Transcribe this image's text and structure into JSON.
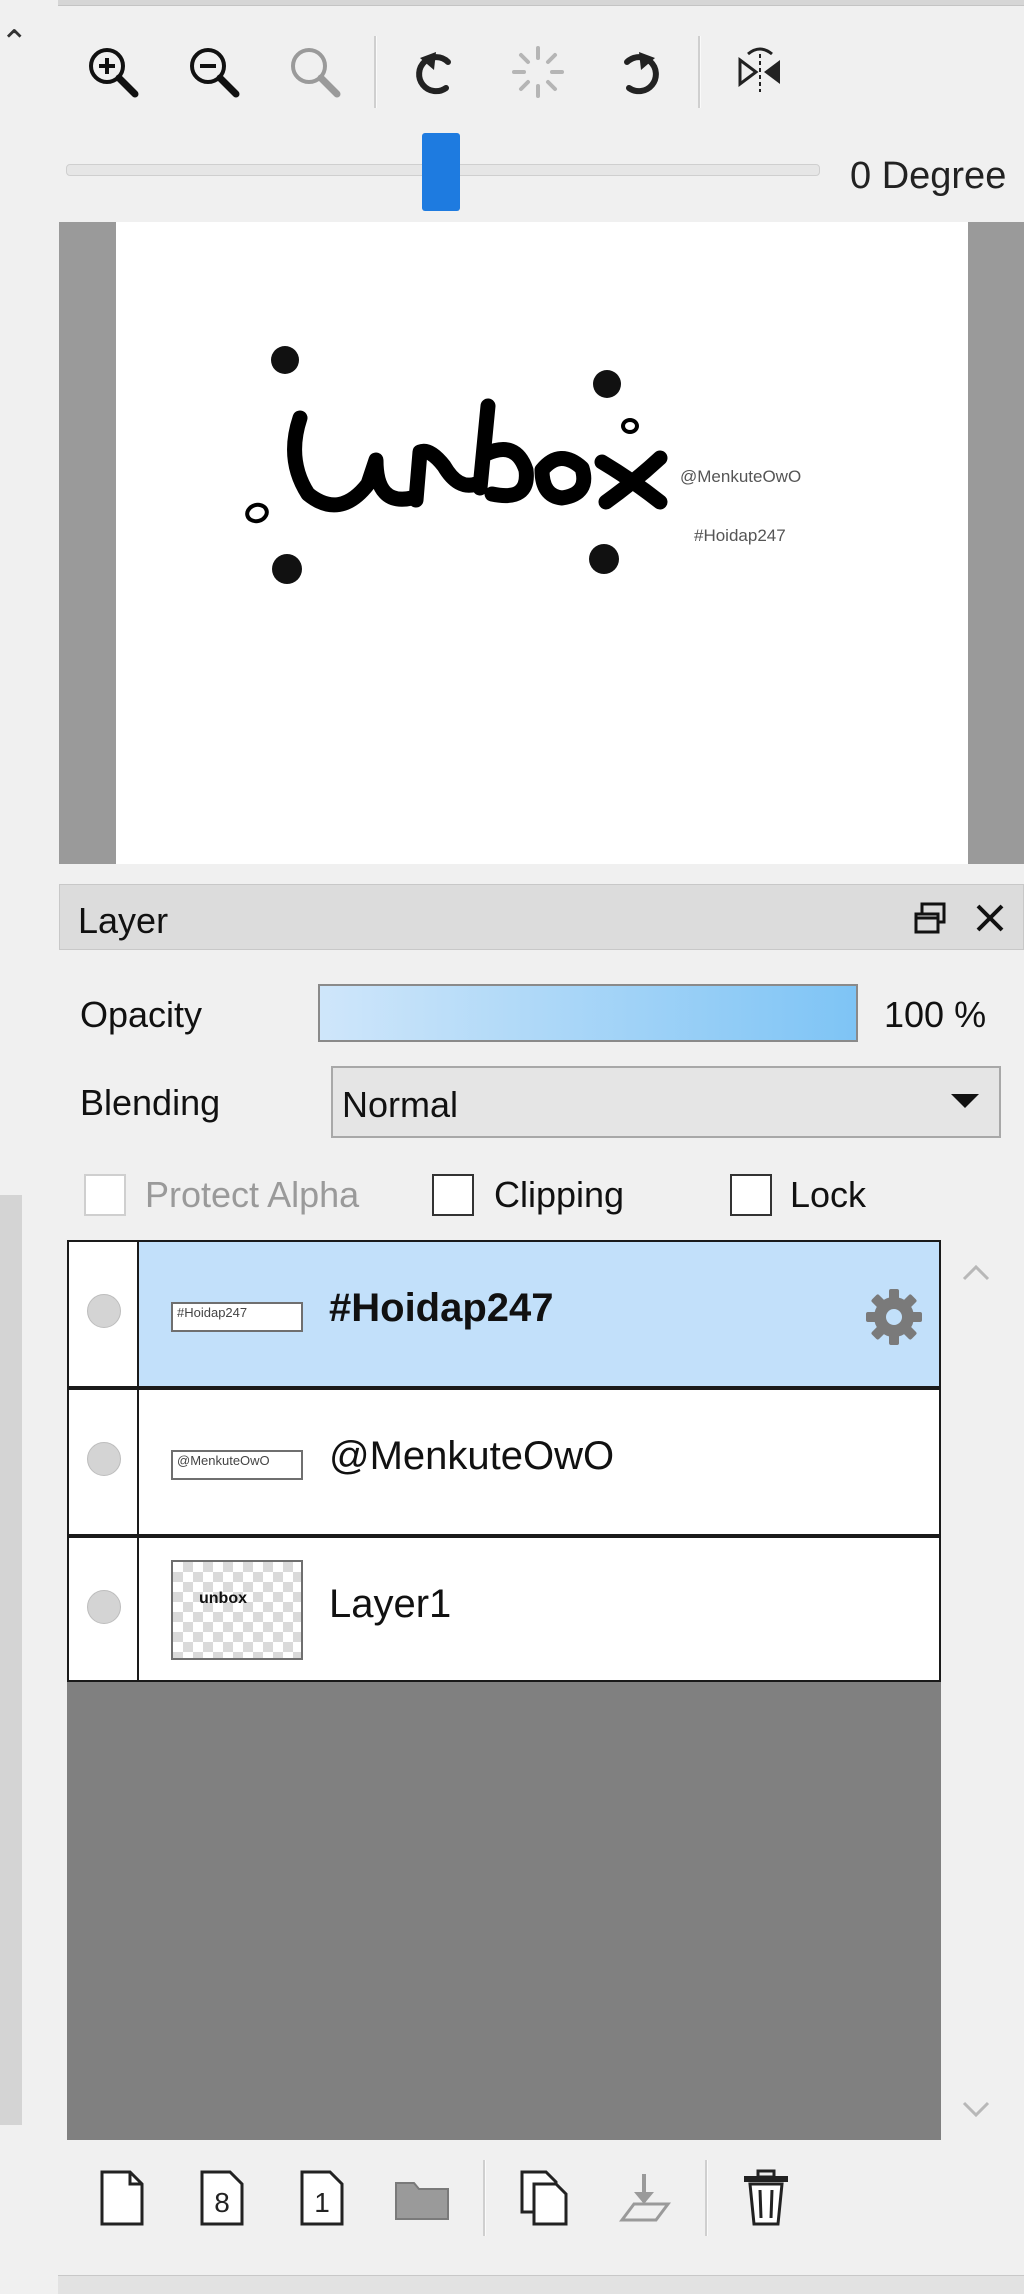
{
  "toolbar": {
    "tools": [
      {
        "name": "zoom-in-icon",
        "enabled": true
      },
      {
        "name": "zoom-out-icon",
        "enabled": true
      },
      {
        "name": "zoom-actual-icon",
        "enabled": false
      },
      {
        "name": "rotate-left-icon",
        "enabled": true
      },
      {
        "name": "rotate-reset-icon",
        "enabled": false
      },
      {
        "name": "rotate-right-icon",
        "enabled": true
      },
      {
        "name": "flip-horizontal-icon",
        "enabled": true
      }
    ]
  },
  "rotation": {
    "label": "0 Degree",
    "value_degrees": 0
  },
  "preview": {
    "art_text": "unbox",
    "watermark_1": "@MenkuteOwO",
    "watermark_2": "#Hoidap247"
  },
  "layer_panel": {
    "title": "Layer",
    "opacity_label": "Opacity",
    "opacity_value": "100 %",
    "opacity_fraction": 1.0,
    "blending_label": "Blending",
    "blending_value": "Normal",
    "protect_alpha_label": "Protect Alpha",
    "clipping_label": "Clipping",
    "lock_label": "Lock",
    "layers": [
      {
        "name": "#Hoidap247",
        "thumb_text": "#Hoidap247",
        "selected": true
      },
      {
        "name": "@MenkuteOwO",
        "thumb_text": "@MenkuteOwO",
        "selected": false
      },
      {
        "name": "Layer1",
        "thumb_text": "unbox",
        "selected": false
      }
    ]
  },
  "bottom_toolbar": {
    "icons": [
      "new-layer-icon",
      "new-8bit-layer-icon",
      "new-1bit-layer-icon",
      "new-folder-icon",
      "duplicate-layer-icon",
      "merge-down-icon",
      "delete-layer-icon"
    ]
  },
  "colors": {
    "accent": "#1e7be0",
    "selected_row": "#c2e0fa",
    "list_background": "#808080"
  }
}
